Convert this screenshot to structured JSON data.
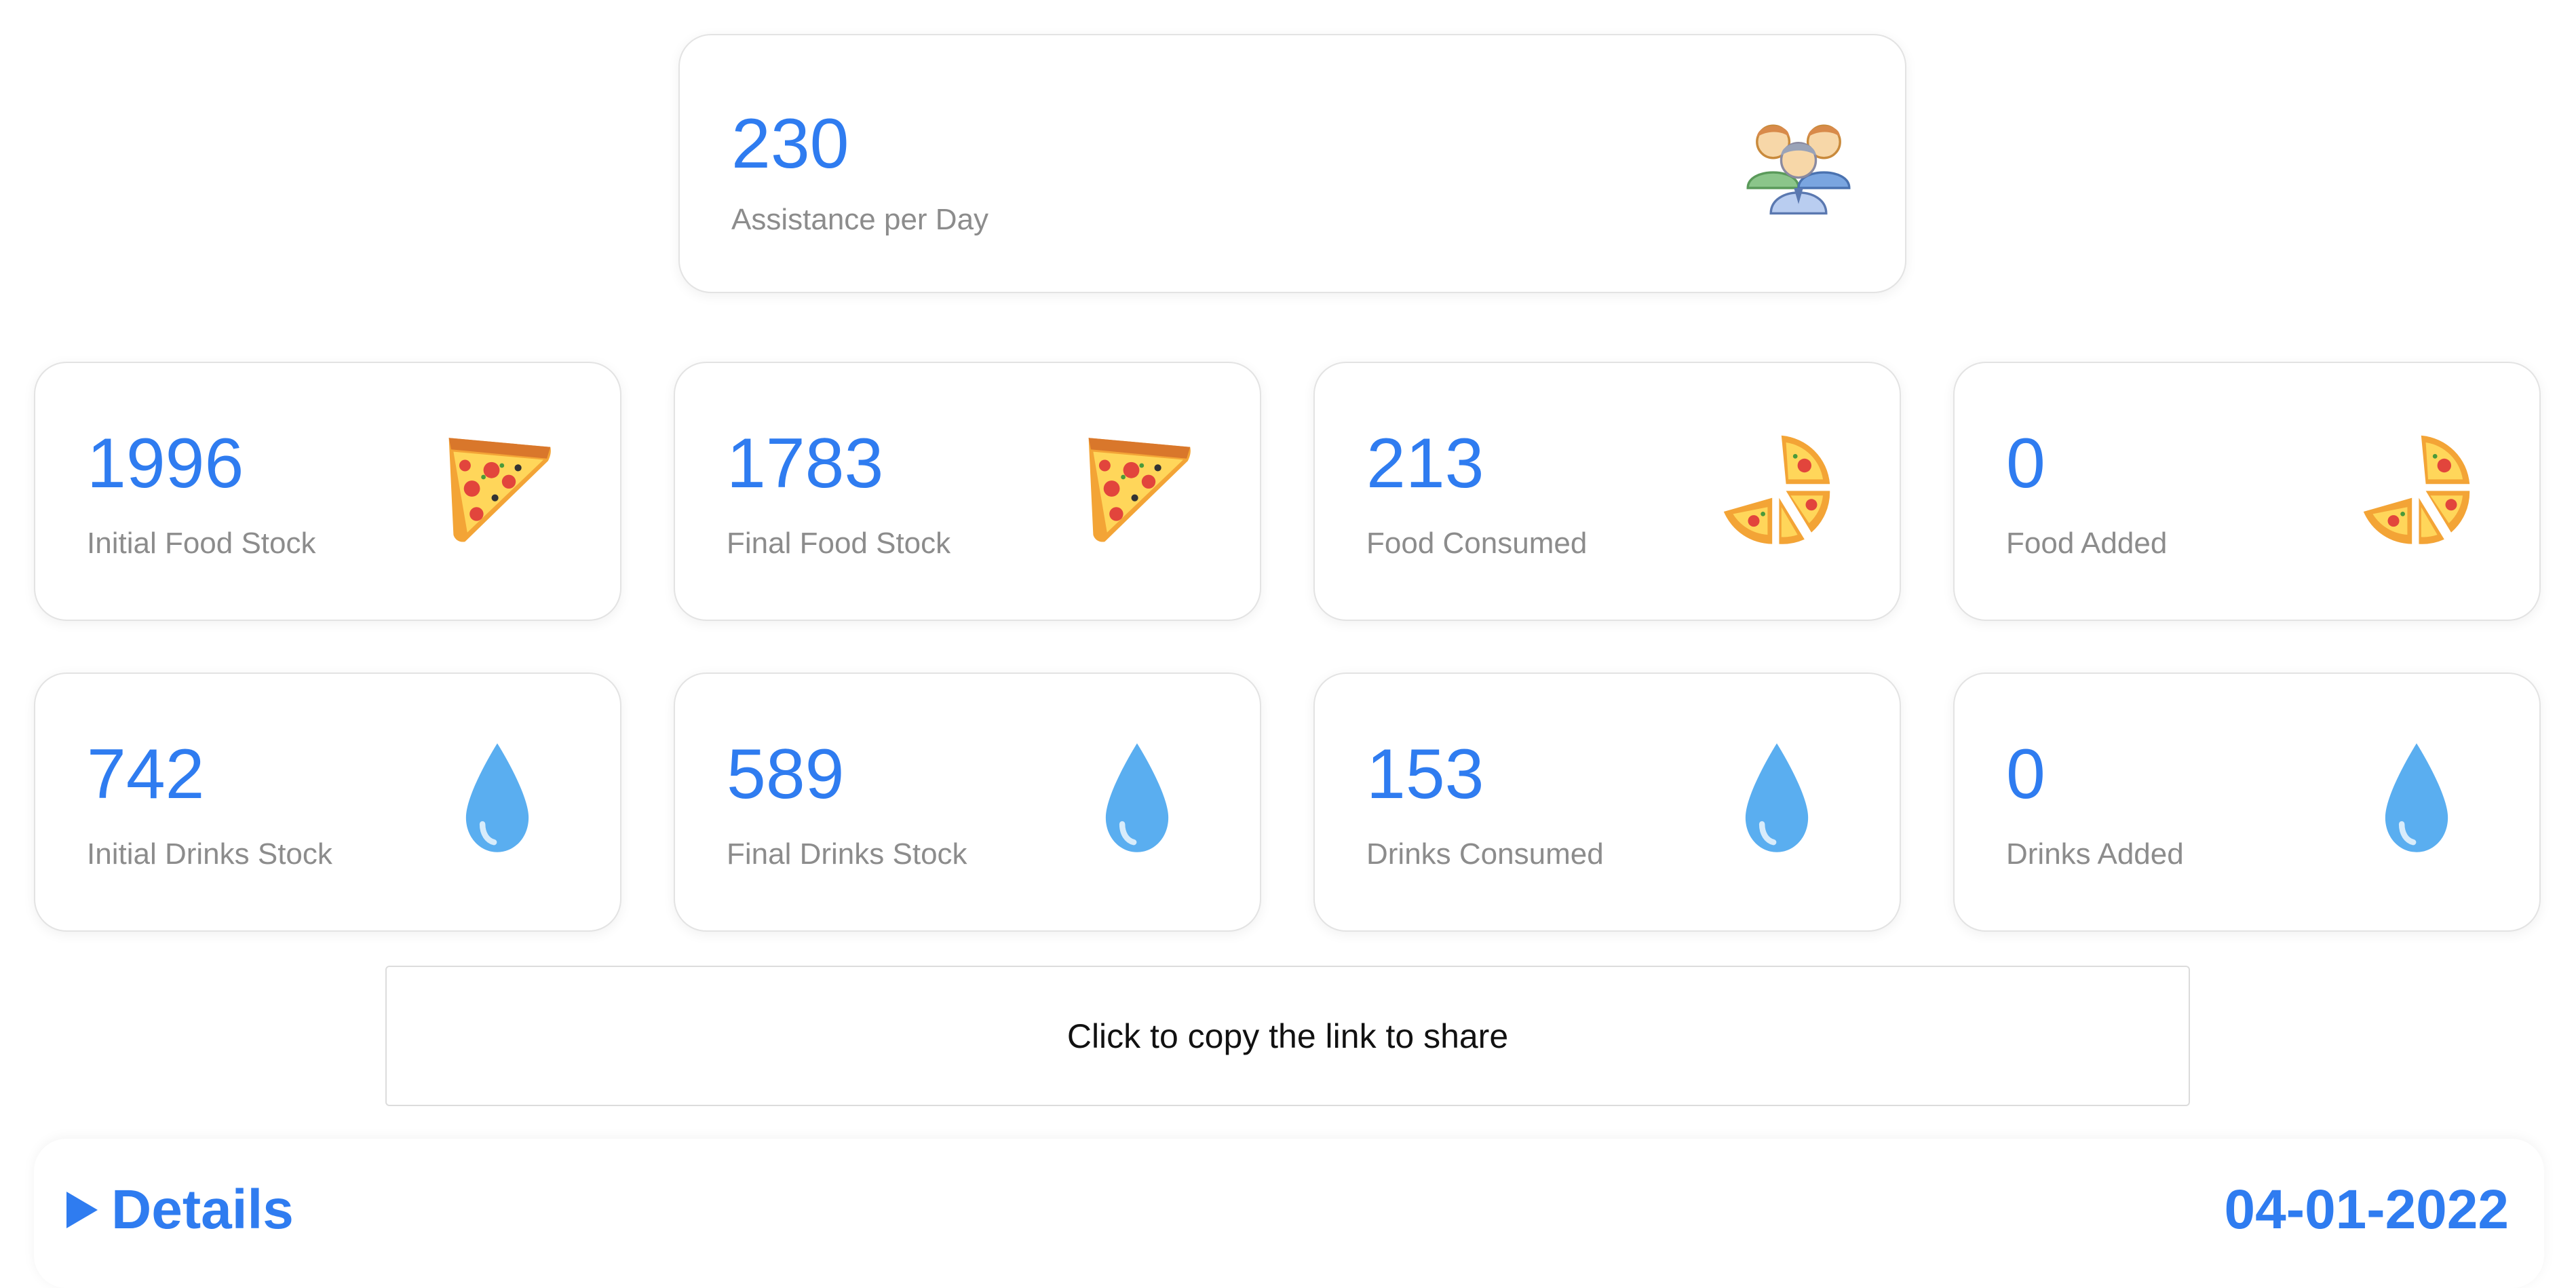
{
  "assistance": {
    "value": "230",
    "label": "Assistance per Day",
    "icon": "people-group-icon"
  },
  "food": [
    {
      "value": "1996",
      "label": "Initial Food Stock",
      "icon": "pizza-slice-icon"
    },
    {
      "value": "1783",
      "label": "Final Food Stock",
      "icon": "pizza-slice-icon"
    },
    {
      "value": "213",
      "label": "Food Consumed",
      "icon": "pizza-pieces-icon"
    },
    {
      "value": "0",
      "label": "Food Added",
      "icon": "pizza-pieces-icon"
    }
  ],
  "drinks": [
    {
      "value": "742",
      "label": "Initial Drinks Stock",
      "icon": "water-drop-icon"
    },
    {
      "value": "589",
      "label": "Final Drinks Stock",
      "icon": "water-drop-icon"
    },
    {
      "value": "153",
      "label": "Drinks Consumed",
      "icon": "water-drop-icon"
    },
    {
      "value": "0",
      "label": "Drinks Added",
      "icon": "water-drop-icon"
    }
  ],
  "share": {
    "label": "Click to copy the link to share"
  },
  "details": {
    "title": "Details",
    "date": "04-01-2022"
  },
  "colors": {
    "accent": "#2f7cf0",
    "label": "#8c8c8c",
    "drop": "#5aaef0"
  }
}
